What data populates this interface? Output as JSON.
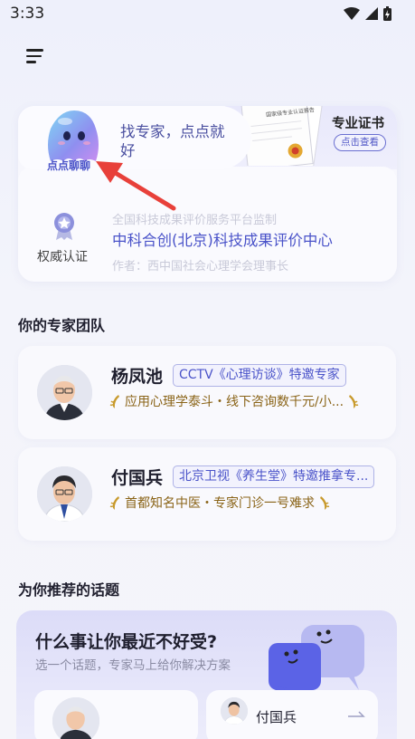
{
  "status_bar": {
    "time": "3:33"
  },
  "hero": {
    "mascot_label": "点点聊聊",
    "prompt": "找专家，点点就好",
    "cert_title": "专业证书",
    "cert_button": "点击查看",
    "cert_doc_text": "国家级专业认证报告",
    "auth_label": "权威认证",
    "auth_line_top": "全国科技成果评价服务平台监制",
    "auth_line_main": "中科合创(北京)科技成果评价中心",
    "auth_line_bottom": "作者：西中国社会心理学会理事长"
  },
  "experts_section": {
    "title": "你的专家团队"
  },
  "experts": [
    {
      "name": "杨凤池",
      "tag": "CCTV《心理访谈》特邀专家",
      "desc": "应用心理学泰斗・线下咨询数千元/小..."
    },
    {
      "name": "付国兵",
      "tag": "北京卫视《养生堂》特邀推拿专...",
      "desc": "首都知名中医・专家门诊一号难求"
    }
  ],
  "topics_section": {
    "title": "为你推荐的话题"
  },
  "topic_card": {
    "title": "什么事让你最近不好受?",
    "subtitle": "选一个话题，专家马上给你解决方案",
    "mini_right_name": "付国兵"
  },
  "colors": {
    "accent": "#4a53c9",
    "gold": "#8a6418",
    "arrow": "#e8403a"
  }
}
